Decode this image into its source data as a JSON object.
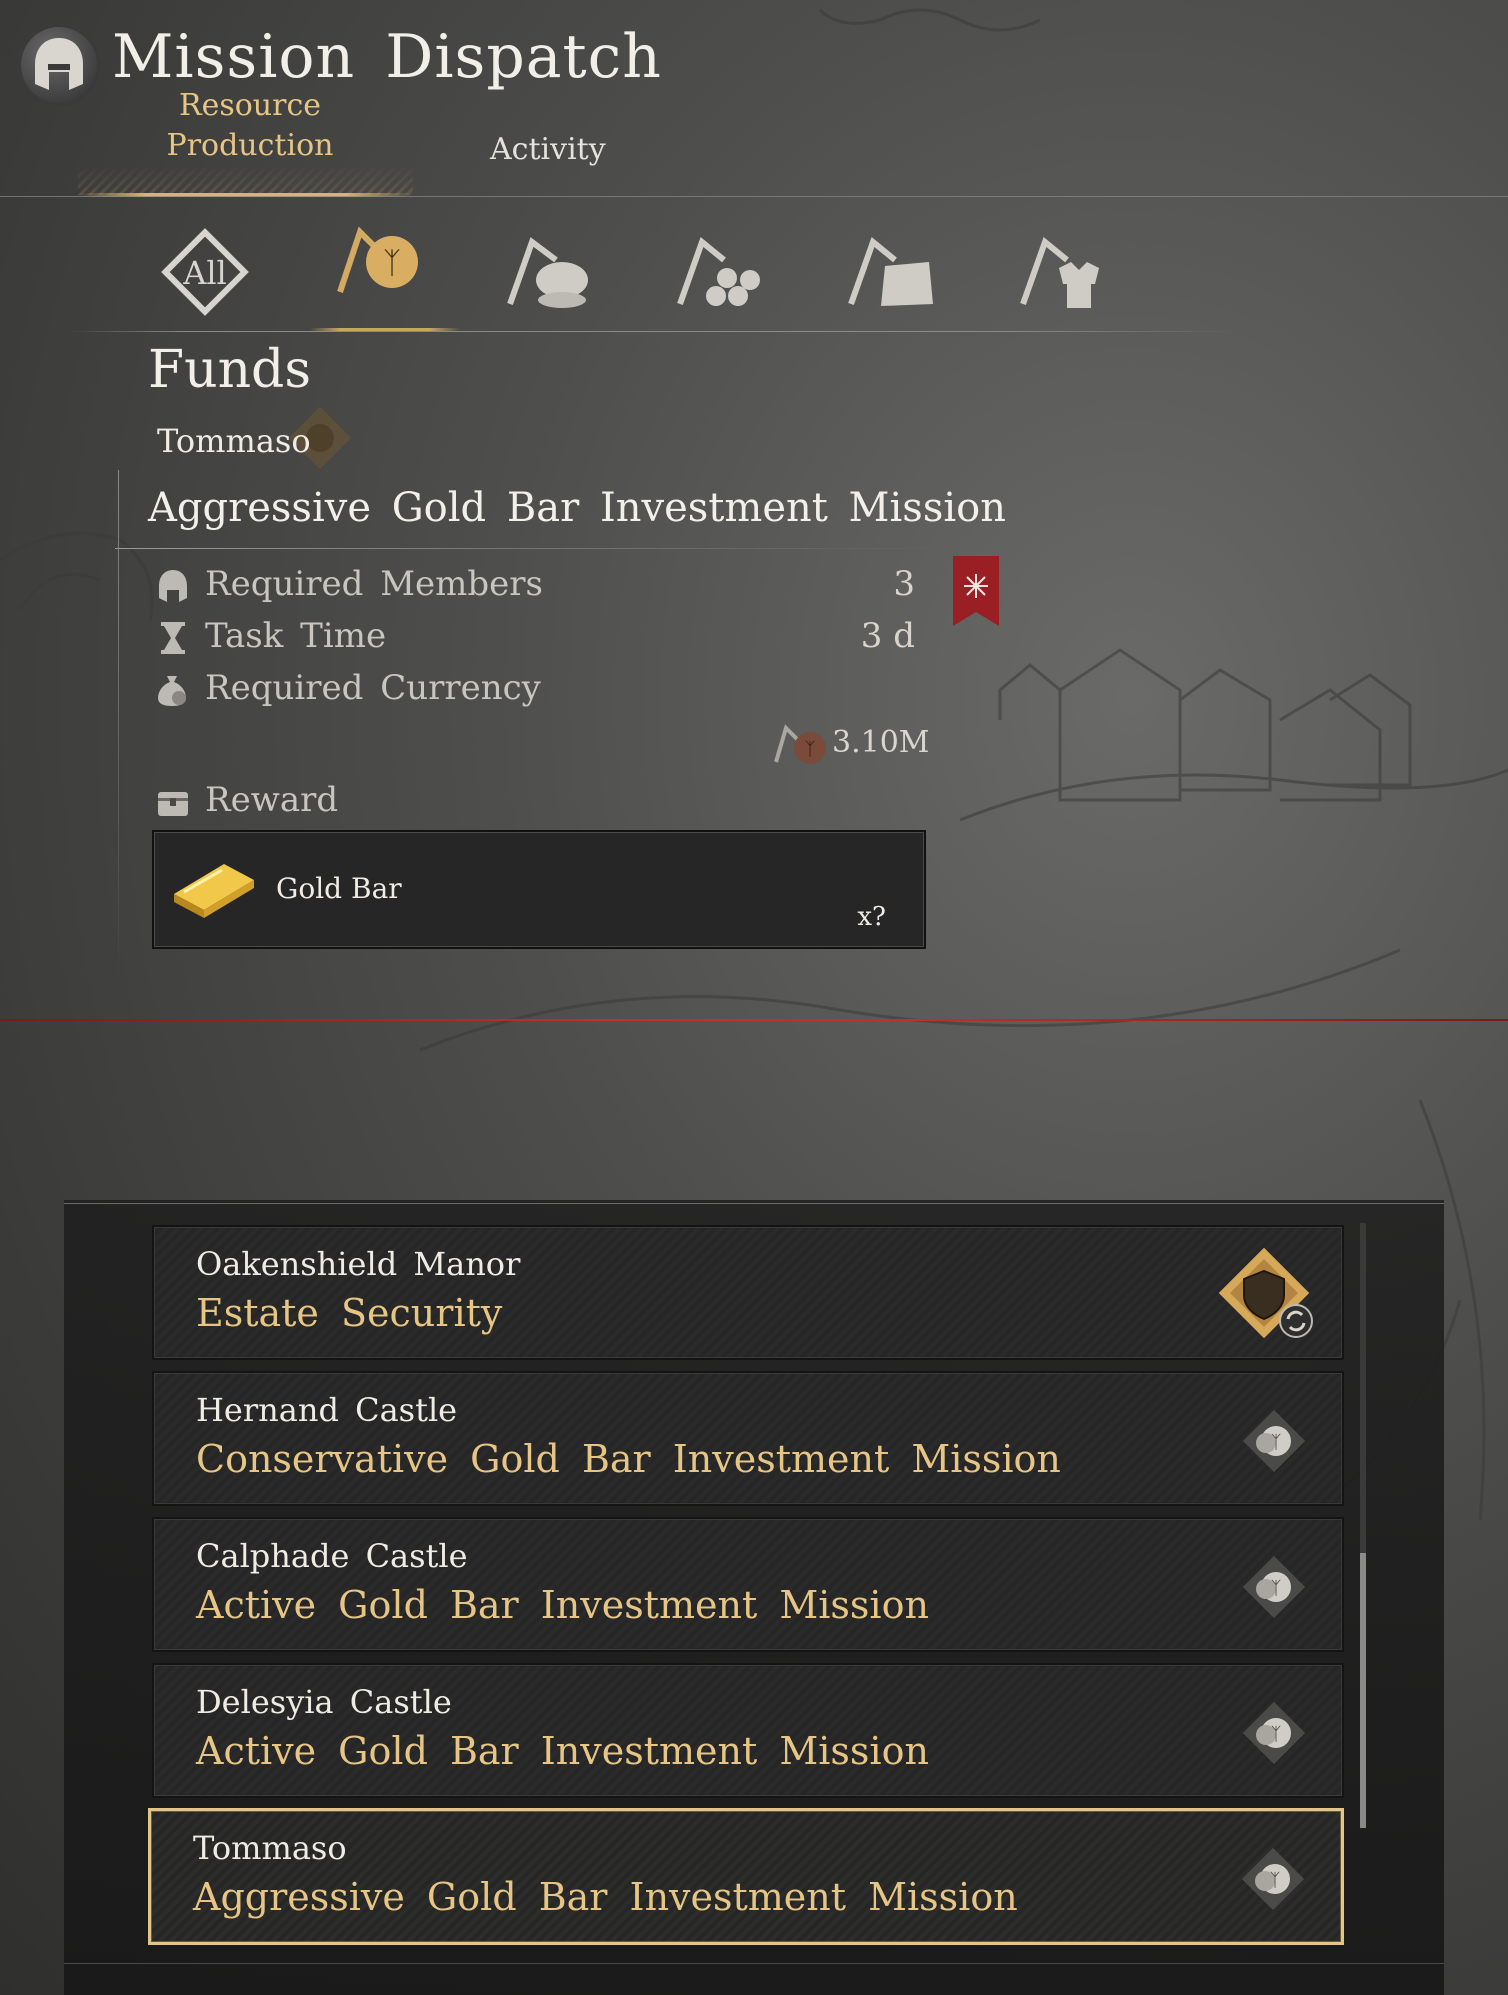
{
  "header": {
    "title": "Mission Dispatch",
    "tabs": [
      {
        "label": "Resource Production",
        "active": true
      },
      {
        "label": "Activity",
        "active": false
      }
    ]
  },
  "categories": [
    {
      "icon": "all-icon",
      "label": "All",
      "active": false
    },
    {
      "icon": "funds-tent-icon",
      "active": true
    },
    {
      "icon": "food-tent-icon",
      "active": false
    },
    {
      "icon": "wood-tent-icon",
      "active": false
    },
    {
      "icon": "stone-tent-icon",
      "active": false
    },
    {
      "icon": "armor-tent-icon",
      "active": false
    }
  ],
  "detail": {
    "category_title": "Funds",
    "owner": "Tommaso",
    "mission_title": "Aggressive Gold Bar Investment Mission",
    "stats": {
      "required_members_label": "Required Members",
      "required_members_value": "3",
      "task_time_label": "Task Time",
      "task_time_value": "3 d",
      "required_currency_label": "Required Currency",
      "required_currency_value": "3.10M"
    },
    "reward_label": "Reward",
    "reward": {
      "name": "Gold Bar",
      "quantity": "x?"
    }
  },
  "missions": [
    {
      "location": "Oakenshield Manor",
      "name": "Estate Security",
      "icon": "shield-icon",
      "selected": false
    },
    {
      "location": "Hernand Castle",
      "name": "Conservative Gold Bar Investment Mission",
      "icon": "coin-icon",
      "selected": false
    },
    {
      "location": "Calphade Castle",
      "name": "Active Gold Bar Investment Mission",
      "icon": "coin-icon",
      "selected": false
    },
    {
      "location": "Delesyia Castle",
      "name": "Active Gold Bar Investment Mission",
      "icon": "coin-icon",
      "selected": false
    },
    {
      "location": "Tommaso",
      "name": "Aggressive Gold Bar Investment Mission",
      "icon": "coin-icon",
      "selected": true
    }
  ],
  "colors": {
    "accent_gold": "#e7c585",
    "selected_border": "#e1c58a",
    "banner_red": "#9a1f24"
  }
}
